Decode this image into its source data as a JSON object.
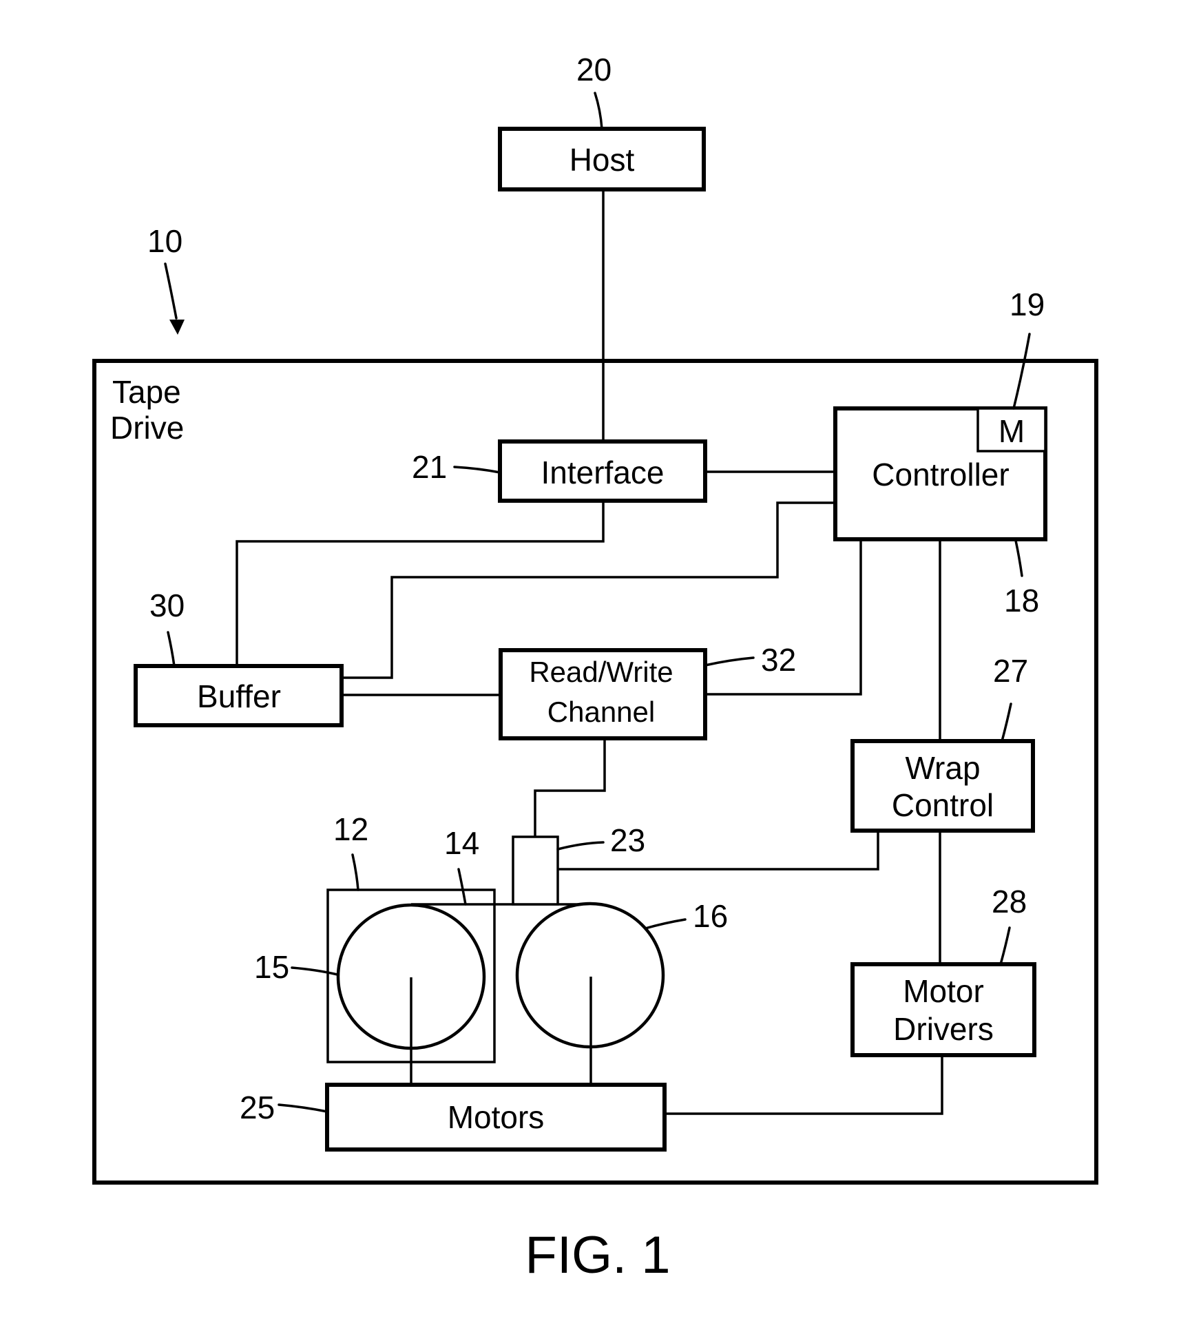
{
  "figure": {
    "caption": "FIG. 1",
    "system_label_line1": "Tape",
    "system_label_line2": "Drive",
    "system_ref": "10"
  },
  "blocks": {
    "host": {
      "label": "Host",
      "ref": "20"
    },
    "interface": {
      "label": "Interface",
      "ref": "21"
    },
    "controller": {
      "label": "Controller",
      "ref": "18"
    },
    "memory": {
      "label": "M",
      "ref": "19"
    },
    "buffer": {
      "label": "Buffer",
      "ref": "30"
    },
    "read_write_channel": {
      "label_line1": "Read/Write",
      "label_line2": "Channel",
      "ref": "32"
    },
    "wrap_control": {
      "label_line1": "Wrap",
      "label_line2": "Control",
      "ref": "27"
    },
    "motor_drivers": {
      "label_line1": "Motor",
      "label_line2": "Drivers",
      "ref": "28"
    },
    "motors": {
      "label": "Motors",
      "ref": "25"
    },
    "head": {
      "ref": "23"
    },
    "cartridge": {
      "ref": "12"
    },
    "tape": {
      "ref": "14"
    },
    "supply_reel": {
      "ref": "15"
    },
    "takeup_reel": {
      "ref": "16"
    }
  },
  "connections": [
    [
      "host",
      "interface"
    ],
    [
      "interface",
      "controller"
    ],
    [
      "interface",
      "buffer"
    ],
    [
      "controller",
      "buffer"
    ],
    [
      "buffer",
      "read_write_channel"
    ],
    [
      "read_write_channel",
      "controller"
    ],
    [
      "read_write_channel",
      "head"
    ],
    [
      "controller",
      "wrap_control"
    ],
    [
      "wrap_control",
      "head"
    ],
    [
      "wrap_control",
      "motor_drivers"
    ],
    [
      "motor_drivers",
      "motors"
    ],
    [
      "motors",
      "supply_reel"
    ],
    [
      "motors",
      "takeup_reel"
    ]
  ]
}
